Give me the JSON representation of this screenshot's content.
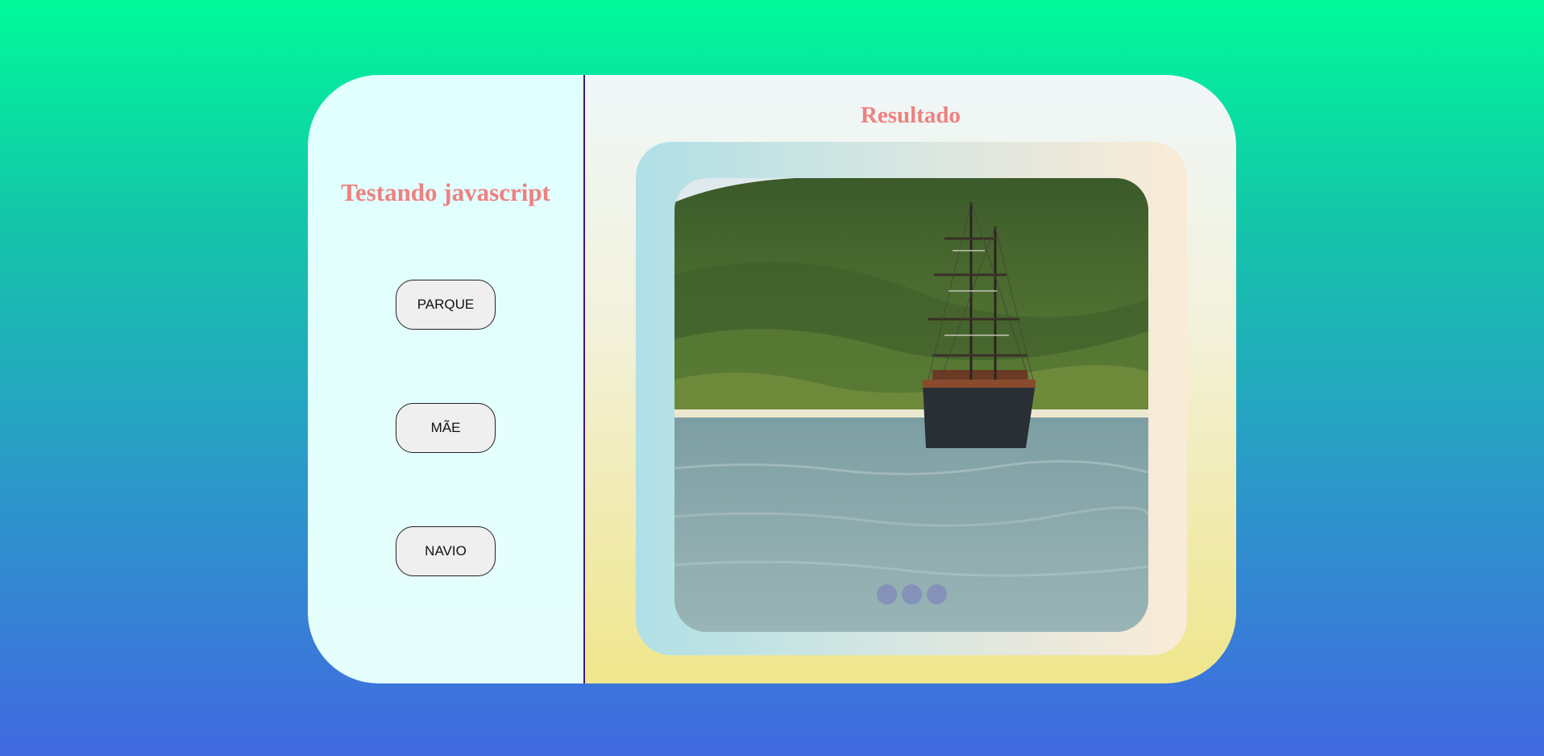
{
  "left": {
    "title": "Testando javascript",
    "buttons": [
      {
        "label": "PARQUE"
      },
      {
        "label": "MÃE"
      },
      {
        "label": "NAVIO"
      }
    ]
  },
  "right": {
    "title": "Resultado",
    "image_icon": "sailing-ship-photo",
    "carousel_dots": 3
  },
  "colors": {
    "title": "#f08080",
    "divider": "#3b1a7a",
    "background_top": "#00fa9a",
    "background_bottom": "#4169e1"
  }
}
